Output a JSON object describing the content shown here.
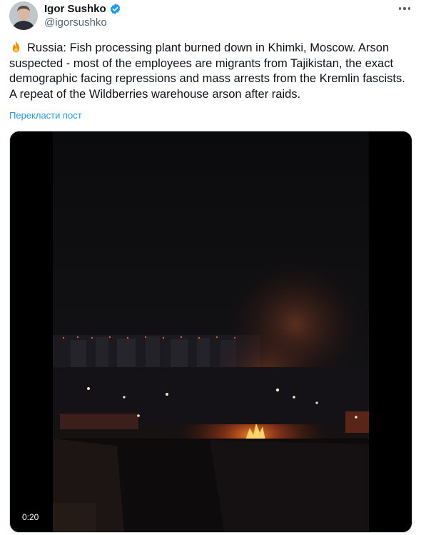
{
  "author": {
    "display_name": "Igor Sushko",
    "handle": "@igorsushko",
    "verified": true
  },
  "tweet": {
    "emoji_icon": "fire-icon",
    "text": "Russia: Fish processing plant burned down in Khimki, Moscow. Arson suspected - most of the employees are migrants from Tajikistan, the exact demographic facing repressions and mass arrests from the Kremlin fascists. A repeat of the Wildberries warehouse arson after raids.",
    "translate_label": "Перекласти пост"
  },
  "video": {
    "duration": "0:20"
  },
  "colors": {
    "link": "#1d9bf0",
    "verified": "#1d9bf0",
    "handle": "#536471"
  }
}
